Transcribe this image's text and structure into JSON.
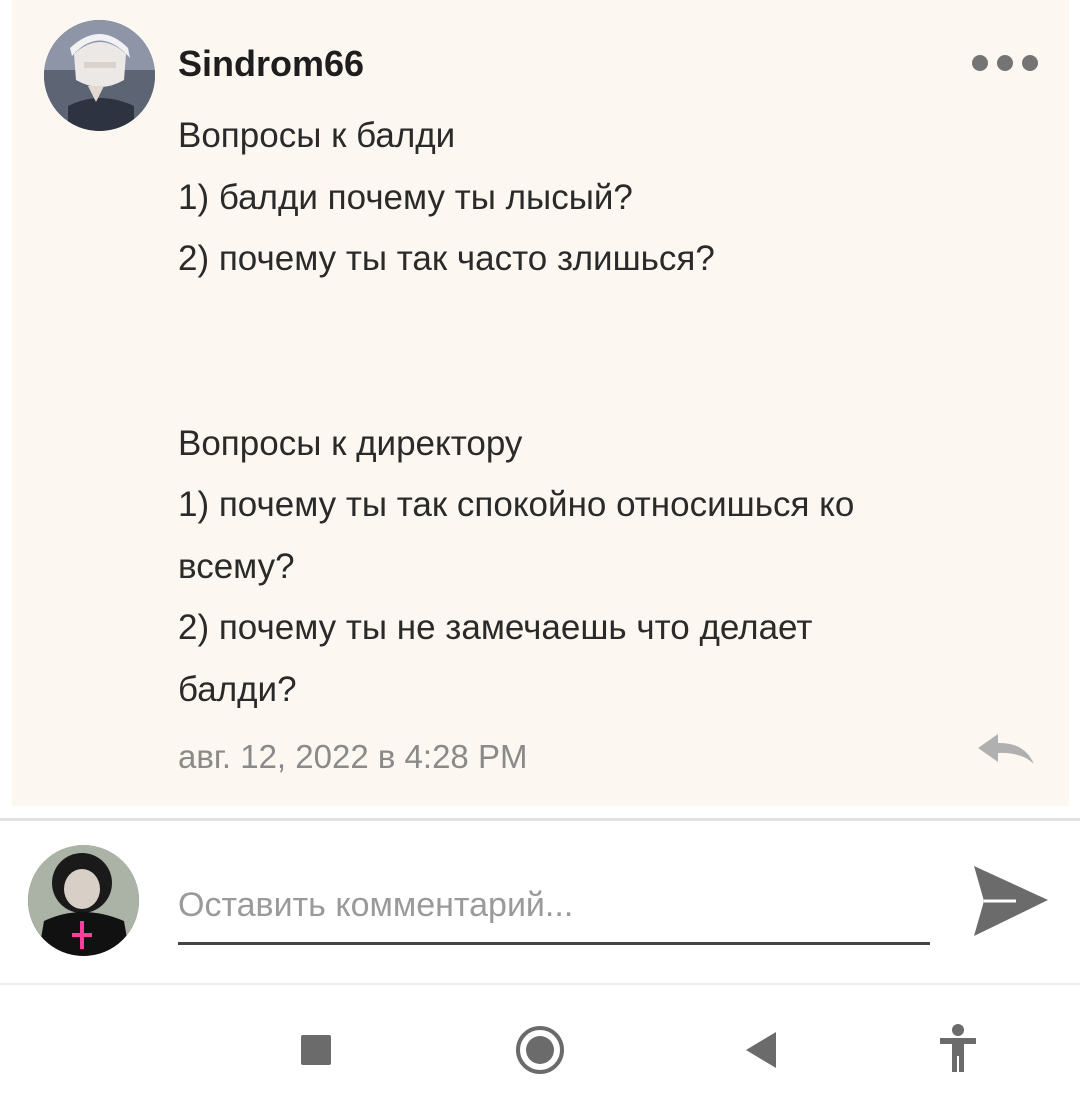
{
  "post": {
    "author": "Sindrom66",
    "more_icon": "more-horizontal-icon",
    "lines": [
      "Вопросы к балди",
      "1) балди почему ты лысый?",
      "2) почему ты так часто злишься?"
    ],
    "lines2": [
      "Вопросы к директору",
      "1) почему ты так спокойно относишься ко",
      "всему?",
      "2) почему ты не замечаешь что делает",
      "балди?"
    ],
    "timestamp": "авг. 12, 2022 в 4:28 PM",
    "reply_icon": "reply-arrow-icon"
  },
  "composer": {
    "placeholder": "Оставить комментарий...",
    "send_icon": "send-icon"
  },
  "navigation": {
    "recent_icon": "square-icon",
    "home_icon": "circle-icon",
    "back_icon": "back-triangle-icon",
    "accessibility_icon": "accessibility-icon"
  },
  "colors": {
    "card_background": "#fcf8f1",
    "text": "#2a2a2a",
    "muted": "#8a8a8a",
    "icon": "#6b6b6b"
  }
}
